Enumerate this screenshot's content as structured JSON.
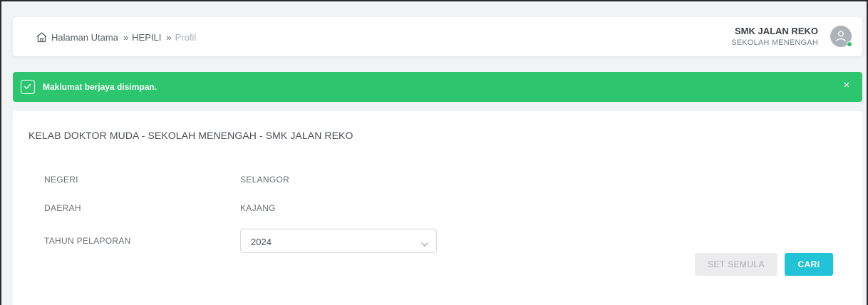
{
  "breadcrumb": {
    "home": "Halaman Utama",
    "separator": "»",
    "middle": "HEPILI",
    "current": "Profil"
  },
  "school": {
    "name": "SMK JALAN REKO",
    "type": "SEKOLAH MENENGAH"
  },
  "alert": {
    "message": "Maklumat berjaya disimpan.",
    "close": "×",
    "color": "#2dc66f"
  },
  "card": {
    "title": "KELAB DOKTOR MUDA - SEKOLAH MENENGAH - SMK JALAN REKO",
    "fields": [
      {
        "label": "NEGERI",
        "value": "SELANGOR"
      },
      {
        "label": "DAERAH",
        "value": "KAJANG"
      }
    ],
    "year_label": "TAHUN PELAPORAN",
    "year_value": "2024"
  },
  "buttons": {
    "reset": "SET SEMULA",
    "search": "CARI",
    "search_color": "#22c3d6"
  },
  "icons": {
    "home": "home-icon",
    "avatar": "user-icon",
    "alert": "check-icon",
    "select": "chevron-down-icon"
  }
}
